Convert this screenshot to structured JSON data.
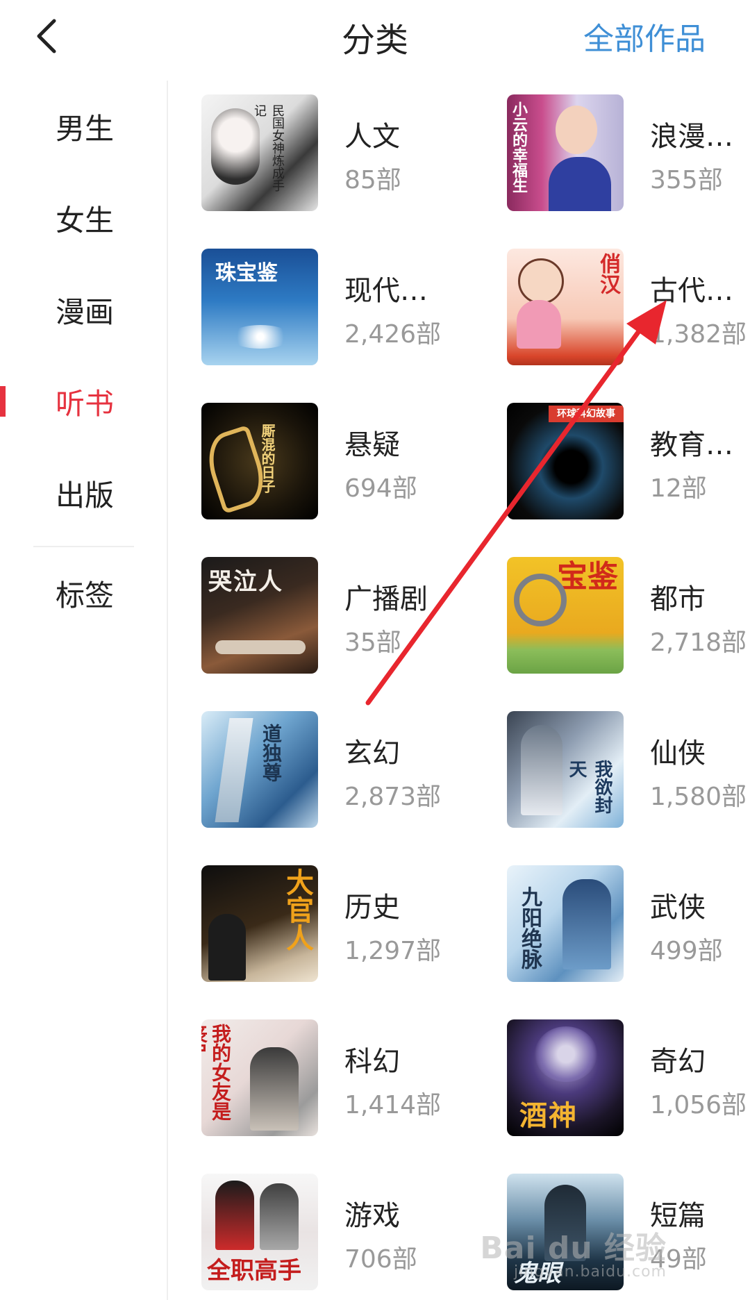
{
  "header": {
    "title": "分类",
    "all_works": "全部作品",
    "back_icon": "chevron-left-icon"
  },
  "sidebar": {
    "items": [
      {
        "label": "男生",
        "active": false
      },
      {
        "label": "女生",
        "active": false
      },
      {
        "label": "漫画",
        "active": false
      },
      {
        "label": "听书",
        "active": true
      },
      {
        "label": "出版",
        "active": false
      }
    ],
    "tag_label": "标签",
    "active_color": "#e6323f"
  },
  "categories": [
    {
      "name": "人文",
      "count": "85部",
      "cover_text": "民国女神炼成手记"
    },
    {
      "name": "浪漫…",
      "count": "355部",
      "cover_text": "小云的幸福生活"
    },
    {
      "name": "现代…",
      "count": "2,426部",
      "cover_text": "珠宝鉴"
    },
    {
      "name": "古代…",
      "count": "1,382部",
      "cover_text": "俏汉"
    },
    {
      "name": "悬疑",
      "count": "694部",
      "cover_text": "厮混的日子"
    },
    {
      "name": "教育…",
      "count": "12部",
      "cover_text": "环球科幻故事"
    },
    {
      "name": "广播剧",
      "count": "35部",
      "cover_text": "哭泣人"
    },
    {
      "name": "都市",
      "count": "2,718部",
      "cover_text": "宝鉴"
    },
    {
      "name": "玄幻",
      "count": "2,873部",
      "cover_text": "道独尊"
    },
    {
      "name": "仙侠",
      "count": "1,580部",
      "cover_text": "我欲封天"
    },
    {
      "name": "历史",
      "count": "1,297部",
      "cover_text": "大官人"
    },
    {
      "name": "武侠",
      "count": "499部",
      "cover_text": "九阳绝脉"
    },
    {
      "name": "科幻",
      "count": "1,414部",
      "cover_text": "我的女友是丧尸"
    },
    {
      "name": "奇幻",
      "count": "1,056部",
      "cover_text": "酒神"
    },
    {
      "name": "游戏",
      "count": "706部",
      "cover_text": "全职高手"
    },
    {
      "name": "短篇",
      "count": "49部",
      "cover_text": "鬼眼"
    }
  ],
  "watermark": {
    "text": "Bai du 经验",
    "sub": "jingyan.baidu.com"
  },
  "colors": {
    "link": "#3f8fd6",
    "arrow": "#e8262e"
  }
}
